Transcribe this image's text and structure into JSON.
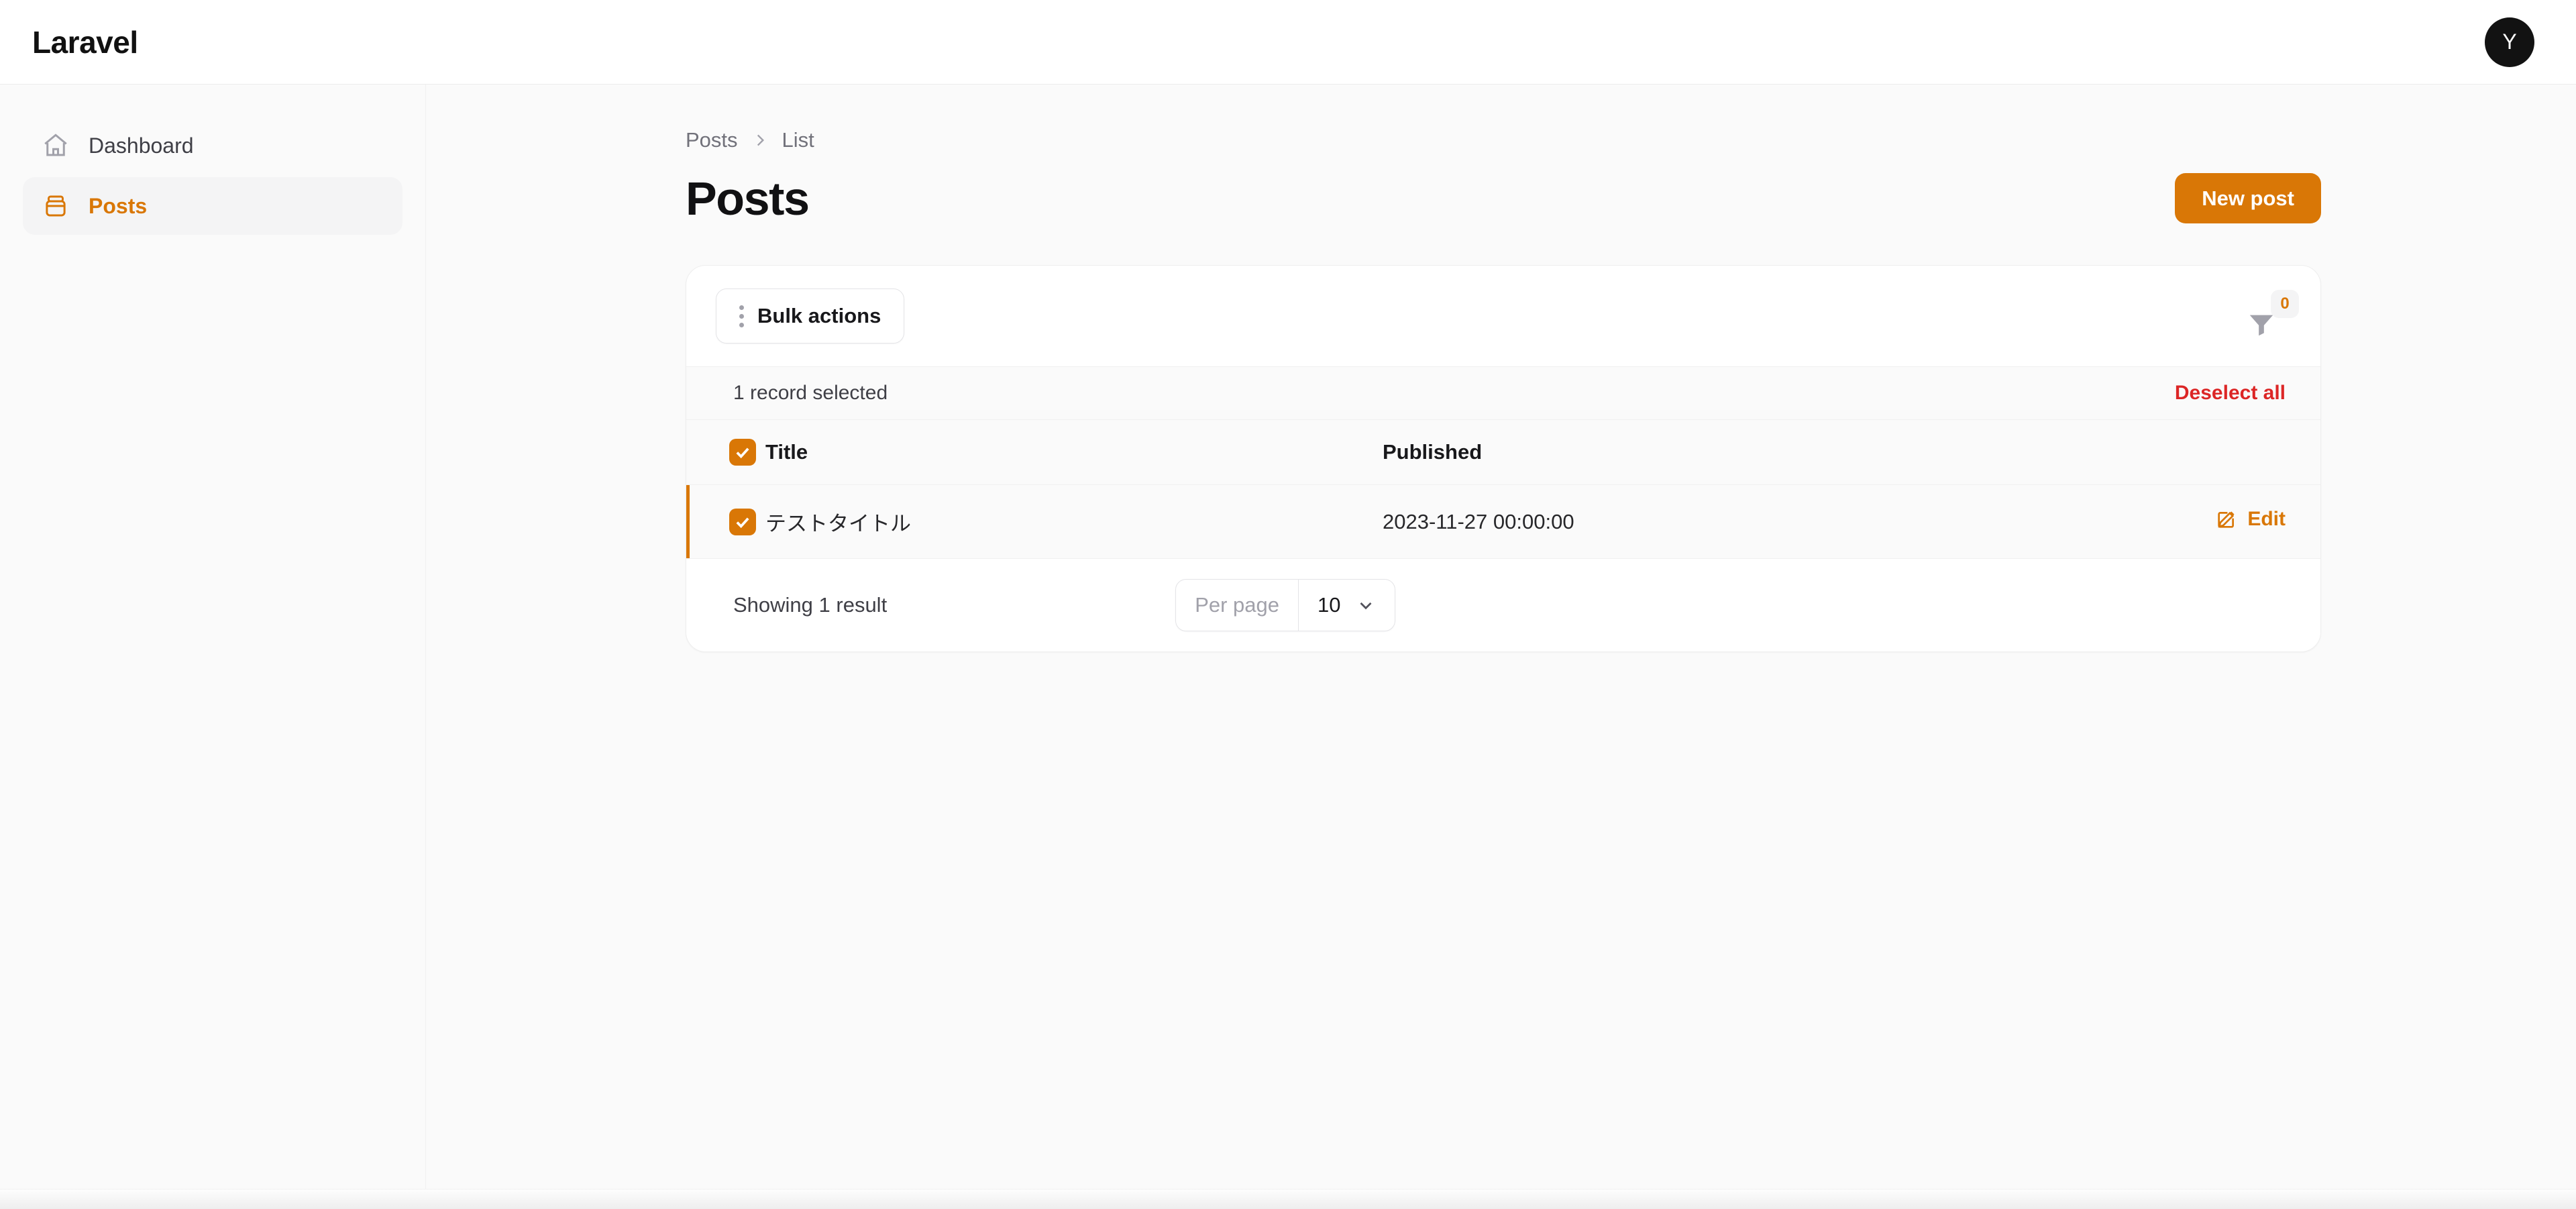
{
  "topbar": {
    "brand": "Laravel",
    "avatar_initial": "Y"
  },
  "sidebar": {
    "items": [
      {
        "label": "Dashboard",
        "icon": "home-icon",
        "active": false
      },
      {
        "label": "Posts",
        "icon": "archive-box-icon",
        "active": true
      }
    ]
  },
  "page": {
    "breadcrumb": [
      "Posts",
      "List"
    ],
    "title": "Posts",
    "new_button": "New post"
  },
  "table": {
    "bulk_actions_label": "Bulk actions",
    "filter_badge": "0",
    "selection_text": "1 record selected",
    "deselect_label": "Deselect all",
    "columns": [
      "Title",
      "Published"
    ],
    "rows": [
      {
        "title": "テストタイトル",
        "published": "2023-11-27 00:00:00",
        "action_label": "Edit",
        "selected": true
      }
    ],
    "showing_text": "Showing 1 result",
    "per_page_label": "Per page",
    "per_page_value": "10"
  },
  "colors": {
    "accent": "#d97706",
    "danger": "#dc2626",
    "avatar_bg": "#121212"
  }
}
